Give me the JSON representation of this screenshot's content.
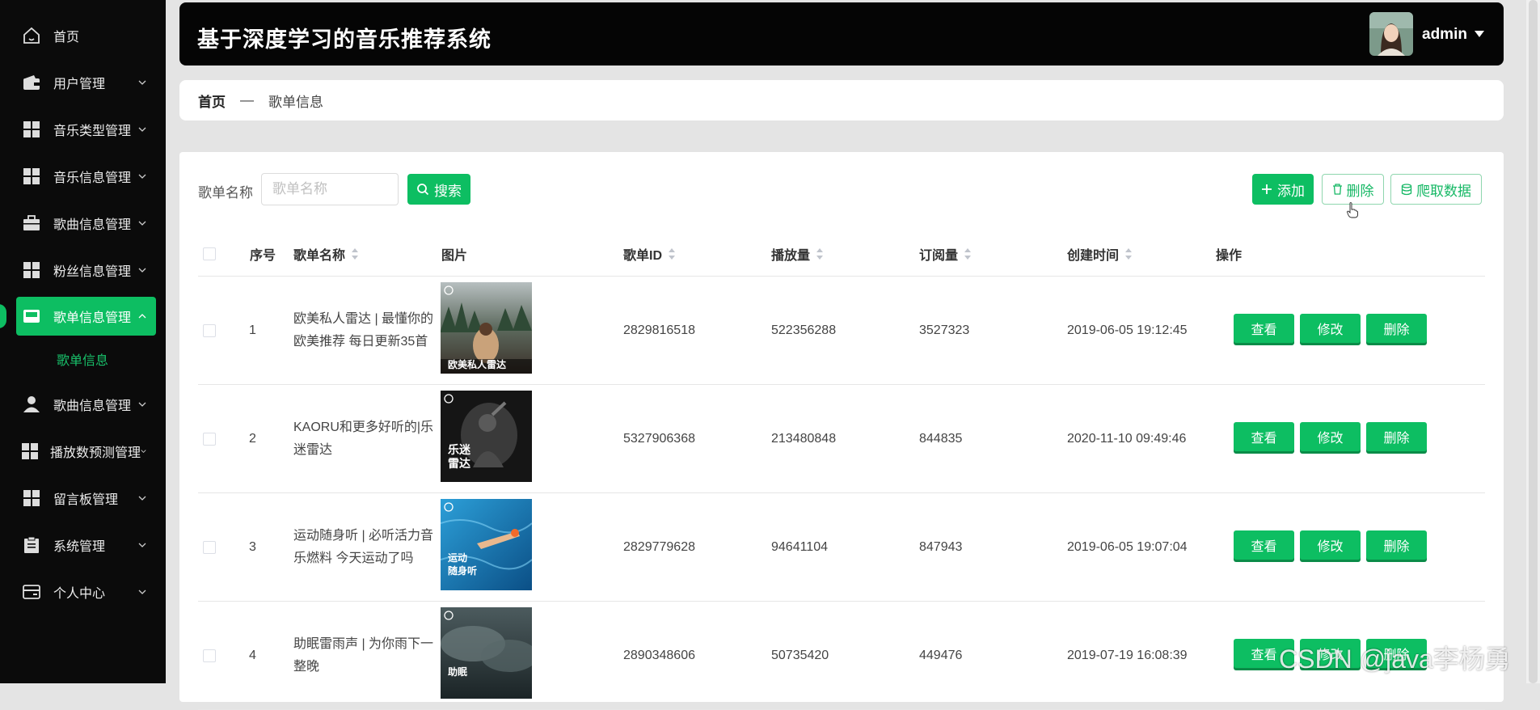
{
  "sidebar": {
    "items": [
      {
        "label": "首页",
        "icon": "home-icon",
        "expandable": false
      },
      {
        "label": "用户管理",
        "icon": "wallet-icon",
        "expandable": true
      },
      {
        "label": "音乐类型管理",
        "icon": "grid-icon",
        "expandable": true
      },
      {
        "label": "音乐信息管理",
        "icon": "grid-icon",
        "expandable": true
      },
      {
        "label": "歌曲信息管理",
        "icon": "briefcase-icon",
        "expandable": true
      },
      {
        "label": "粉丝信息管理",
        "icon": "grid-icon",
        "expandable": true
      },
      {
        "label": "歌单信息管理",
        "icon": "inbox-icon",
        "expandable": true,
        "active": true
      },
      {
        "label": "歌曲信息管理",
        "icon": "person-icon",
        "expandable": true
      },
      {
        "label": "播放数预测管理",
        "icon": "grid-icon",
        "expandable": true
      },
      {
        "label": "留言板管理",
        "icon": "grid-icon",
        "expandable": true
      },
      {
        "label": "系统管理",
        "icon": "clipboard-icon",
        "expandable": true
      },
      {
        "label": "个人中心",
        "icon": "card-icon",
        "expandable": true
      }
    ],
    "sub_item": "歌单信息"
  },
  "header": {
    "title": "基于深度学习的音乐推荐系统",
    "username": "admin"
  },
  "breadcrumb": {
    "home": "首页",
    "separator": "—",
    "current": "歌单信息"
  },
  "toolbar": {
    "search_label": "歌单名称",
    "search_placeholder": "歌单名称",
    "search_button": "搜索",
    "add_button": "添加",
    "delete_button": "删除",
    "crawl_button": "爬取数据"
  },
  "table": {
    "headers": [
      "序号",
      "歌单名称",
      "图片",
      "歌单ID",
      "播放量",
      "订阅量",
      "创建时间",
      "操作"
    ],
    "rows": [
      {
        "index": "1",
        "name": "欧美私人雷达 | 最懂你的欧美推荐 每日更新35首",
        "cover_text": "欧美私人雷达",
        "id": "2829816518",
        "plays": "522356288",
        "subs": "3527323",
        "created": "2019-06-05 19:12:45"
      },
      {
        "index": "2",
        "name": "KAORU和更多好听的|乐迷雷达",
        "cover_text": "乐迷\n雷达",
        "id": "5327906368",
        "plays": "213480848",
        "subs": "844835",
        "created": "2020-11-10 09:49:46"
      },
      {
        "index": "3",
        "name": "运动随身听 | 必听活力音乐燃料 今天运动了吗",
        "cover_text": "运动\n随身听",
        "id": "2829779628",
        "plays": "94641104",
        "subs": "847943",
        "created": "2019-06-05 19:07:04"
      },
      {
        "index": "4",
        "name": "助眠雷雨声 | 为你雨下一整晚",
        "cover_text": "助眠",
        "id": "2890348606",
        "plays": "50735420",
        "subs": "449476",
        "created": "2019-07-19 16:08:39"
      }
    ],
    "actions": {
      "view": "查看",
      "edit": "修改",
      "delete": "删除"
    }
  },
  "watermark": "CSDN @java李杨勇",
  "colors": {
    "accent": "#0dbe62",
    "sidebar_bg": "#0b0b0b",
    "header_bg": "#050505"
  }
}
